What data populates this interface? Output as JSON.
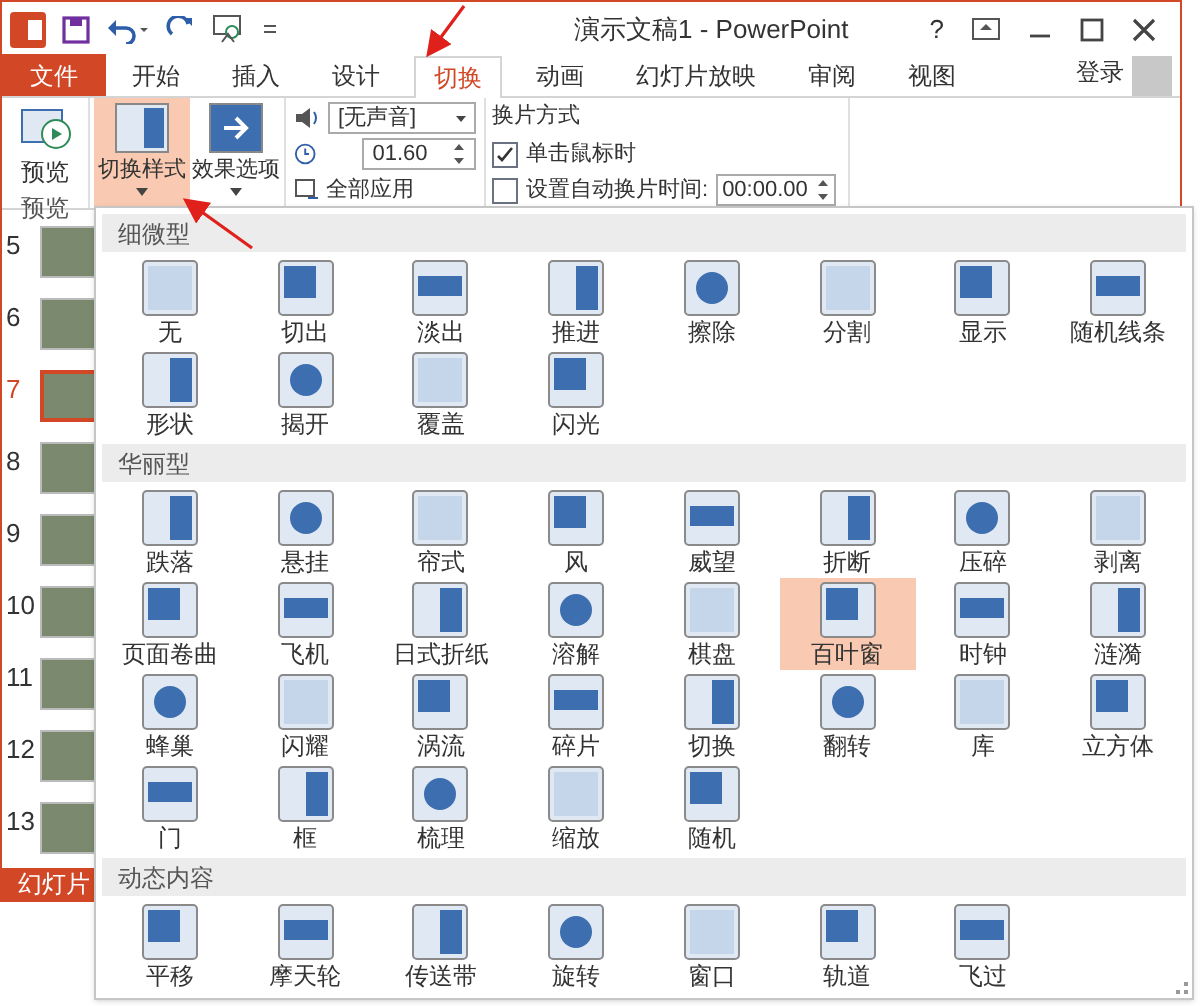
{
  "title_bar": {
    "title": "演示文稿1 - PowerPoint",
    "help": "?"
  },
  "tabs": [
    {
      "label": "文件",
      "kind": "file",
      "selected": false
    },
    {
      "label": "开始",
      "kind": "tab",
      "selected": false
    },
    {
      "label": "插入",
      "kind": "tab",
      "selected": false
    },
    {
      "label": "设计",
      "kind": "tab",
      "selected": false
    },
    {
      "label": "切换",
      "kind": "tab",
      "selected": true
    },
    {
      "label": "动画",
      "kind": "tab",
      "selected": false
    },
    {
      "label": "幻灯片放映",
      "kind": "tab",
      "selected": false
    },
    {
      "label": "审阅",
      "kind": "tab",
      "selected": false
    },
    {
      "label": "视图",
      "kind": "tab",
      "selected": false
    }
  ],
  "account": {
    "label": "登录"
  },
  "ribbon": {
    "preview": {
      "label": "预览",
      "group": "预览"
    },
    "transition_style": {
      "label": "切换样式",
      "expanded": true
    },
    "effect_options": {
      "label": "效果选项",
      "expanded": false
    },
    "sound": {
      "value": "[无声音]"
    },
    "duration": {
      "value": "01.60"
    },
    "apply_all": {
      "label": "全部应用"
    },
    "advance": {
      "title": "换片方式",
      "on_click": {
        "label": "单击鼠标时",
        "checked": true
      },
      "after": {
        "label": "设置自动换片时间:",
        "checked": false,
        "value": "00:00.00"
      }
    }
  },
  "slides": [
    {
      "number": "5",
      "selected": false
    },
    {
      "number": "6",
      "selected": false
    },
    {
      "number": "7",
      "selected": true
    },
    {
      "number": "8",
      "selected": false
    },
    {
      "number": "9",
      "selected": false
    },
    {
      "number": "10",
      "selected": false
    },
    {
      "number": "11",
      "selected": false
    },
    {
      "number": "12",
      "selected": false
    },
    {
      "number": "13",
      "selected": false
    }
  ],
  "status_bar": {
    "text": "幻灯片"
  },
  "gallery": {
    "sections": [
      {
        "title": "细微型",
        "items": [
          {
            "label": "无",
            "selected": false
          },
          {
            "label": "切出",
            "selected": false
          },
          {
            "label": "淡出",
            "selected": false
          },
          {
            "label": "推进",
            "selected": false
          },
          {
            "label": "擦除",
            "selected": false
          },
          {
            "label": "分割",
            "selected": false
          },
          {
            "label": "显示",
            "selected": false
          },
          {
            "label": "随机线条",
            "selected": false
          },
          {
            "label": "形状",
            "selected": false
          },
          {
            "label": "揭开",
            "selected": false
          },
          {
            "label": "覆盖",
            "selected": false
          },
          {
            "label": "闪光",
            "selected": false
          }
        ]
      },
      {
        "title": "华丽型",
        "items": [
          {
            "label": "跌落",
            "selected": false
          },
          {
            "label": "悬挂",
            "selected": false
          },
          {
            "label": "帘式",
            "selected": false
          },
          {
            "label": "风",
            "selected": false
          },
          {
            "label": "威望",
            "selected": false
          },
          {
            "label": "折断",
            "selected": false
          },
          {
            "label": "压碎",
            "selected": false
          },
          {
            "label": "剥离",
            "selected": false
          },
          {
            "label": "页面卷曲",
            "selected": false
          },
          {
            "label": "飞机",
            "selected": false
          },
          {
            "label": "日式折纸",
            "selected": false
          },
          {
            "label": "溶解",
            "selected": false
          },
          {
            "label": "棋盘",
            "selected": false
          },
          {
            "label": "百叶窗",
            "selected": true
          },
          {
            "label": "时钟",
            "selected": false
          },
          {
            "label": "涟漪",
            "selected": false
          },
          {
            "label": "蜂巢",
            "selected": false
          },
          {
            "label": "闪耀",
            "selected": false
          },
          {
            "label": "涡流",
            "selected": false
          },
          {
            "label": "碎片",
            "selected": false
          },
          {
            "label": "切换",
            "selected": false
          },
          {
            "label": "翻转",
            "selected": false
          },
          {
            "label": "库",
            "selected": false
          },
          {
            "label": "立方体",
            "selected": false
          },
          {
            "label": "门",
            "selected": false
          },
          {
            "label": "框",
            "selected": false
          },
          {
            "label": "梳理",
            "selected": false
          },
          {
            "label": "缩放",
            "selected": false
          },
          {
            "label": "随机",
            "selected": false
          }
        ]
      },
      {
        "title": "动态内容",
        "items": [
          {
            "label": "平移",
            "selected": false
          },
          {
            "label": "摩天轮",
            "selected": false
          },
          {
            "label": "传送带",
            "selected": false
          },
          {
            "label": "旋转",
            "selected": false
          },
          {
            "label": "窗口",
            "selected": false
          },
          {
            "label": "轨道",
            "selected": false
          },
          {
            "label": "飞过",
            "selected": false
          }
        ]
      }
    ]
  }
}
